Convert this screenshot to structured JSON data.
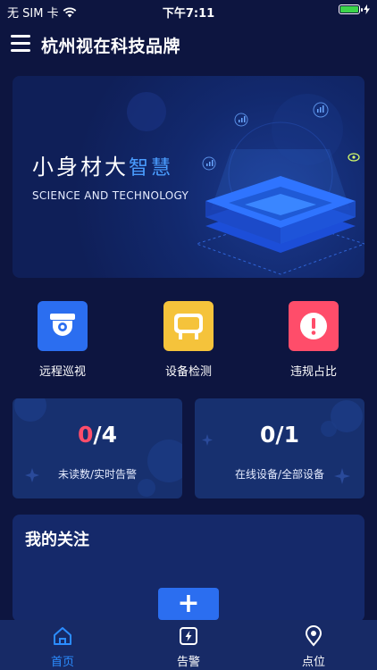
{
  "status_bar": {
    "carrier": "无 SIM 卡",
    "time": "下午7:11",
    "battery_level": 1.0,
    "battery_color": "#3cd44a"
  },
  "nav": {
    "title": "杭州视在科技品牌",
    "menu_icon": "hamburger-menu-icon"
  },
  "banner": {
    "title_main": "小身材大",
    "title_highlight": "智慧",
    "subtitle": "SCIENCE AND TECHNOLOGY",
    "highlight_color": "#4a9dff"
  },
  "features": [
    {
      "label": "远程巡视",
      "icon": "camera-icon",
      "color": "#2b6ef0"
    },
    {
      "label": "设备检测",
      "icon": "device-icon",
      "color": "#f5c33b"
    },
    {
      "label": "违规占比",
      "icon": "alert-icon",
      "color": "#ff4d6a"
    }
  ],
  "stats": [
    {
      "current": "0",
      "sep": "/",
      "total": "4",
      "caption": "未读数/实时告警",
      "current_color": "#ff4d6a"
    },
    {
      "current": "0",
      "sep": "/",
      "total": "1",
      "caption": "在线设备/全部设备",
      "current_color": "#ffffff"
    }
  ],
  "focus": {
    "title": "我的关注",
    "add_label": "+"
  },
  "tabbar": {
    "active_color": "#2b8cff",
    "items": [
      {
        "label": "首页",
        "icon": "home-icon",
        "active": true
      },
      {
        "label": "告警",
        "icon": "alarm-icon",
        "active": false
      },
      {
        "label": "点位",
        "icon": "location-pin-icon",
        "active": false
      }
    ]
  }
}
